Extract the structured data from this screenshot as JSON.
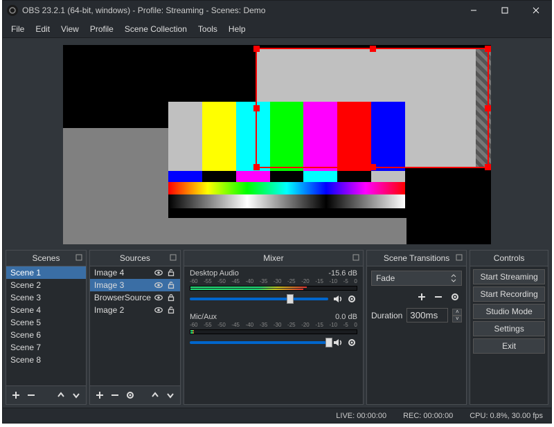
{
  "title": "OBS 23.2.1 (64-bit, windows) - Profile: Streaming - Scenes: Demo",
  "menu": [
    "File",
    "Edit",
    "View",
    "Profile",
    "Scene Collection",
    "Tools",
    "Help"
  ],
  "docks": {
    "scenes": {
      "title": "Scenes"
    },
    "sources": {
      "title": "Sources"
    },
    "mixer": {
      "title": "Mixer"
    },
    "transitions": {
      "title": "Scene Transitions"
    },
    "controls": {
      "title": "Controls"
    }
  },
  "scenes": [
    "Scene 1",
    "Scene 2",
    "Scene 3",
    "Scene 4",
    "Scene 5",
    "Scene 6",
    "Scene 7",
    "Scene 8"
  ],
  "scenes_selected": 0,
  "sources": [
    {
      "name": "Image 4",
      "visible": true,
      "locked": false,
      "selected": false
    },
    {
      "name": "Image 3",
      "visible": true,
      "locked": false,
      "selected": true
    },
    {
      "name": "BrowserSource",
      "visible": true,
      "locked": true,
      "selected": false
    },
    {
      "name": "Image 2",
      "visible": true,
      "locked": false,
      "selected": false
    }
  ],
  "mixer": {
    "channels": [
      {
        "name": "Desktop Audio",
        "level": "-15.6 dB",
        "slider": 0.7
      },
      {
        "name": "Mic/Aux",
        "level": "0.0 dB",
        "slider": 0.98
      }
    ],
    "scale": [
      "-60",
      "-55",
      "-50",
      "-45",
      "-40",
      "-35",
      "-30",
      "-25",
      "-20",
      "-15",
      "-10",
      "-5",
      "0"
    ]
  },
  "transitions": {
    "current": "Fade",
    "duration_label": "Duration",
    "duration_value": "300ms"
  },
  "controls": [
    "Start Streaming",
    "Start Recording",
    "Studio Mode",
    "Settings",
    "Exit"
  ],
  "status": {
    "live": "LIVE: 00:00:00",
    "rec": "REC: 00:00:00",
    "cpu": "CPU: 0.8%, 30.00 fps"
  }
}
